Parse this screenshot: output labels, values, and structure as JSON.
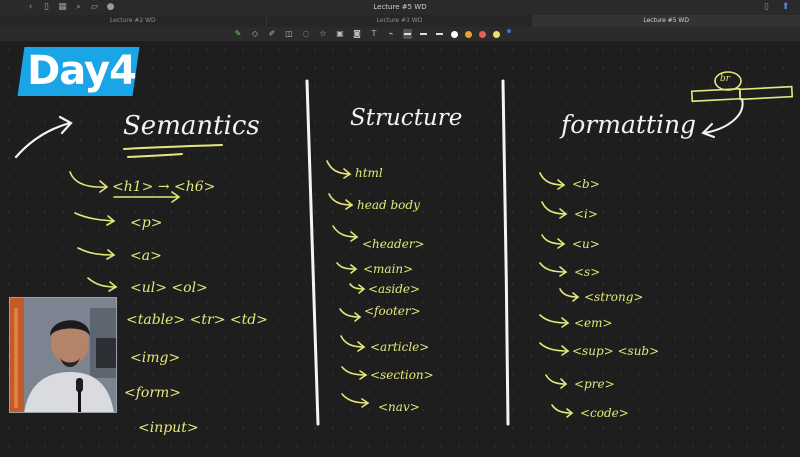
{
  "titlebar": {
    "document_title": "Lecture #5 WD",
    "icons": [
      "back-icon",
      "sidebar-icon",
      "grid-icon",
      "search-icon",
      "bookmark-icon",
      "mic-icon"
    ],
    "right_icons": [
      "bookmark-icon",
      "share-icon"
    ]
  },
  "tabs": [
    {
      "label": "Lecture #2 WD",
      "active": false
    },
    {
      "label": "Lecture #3 WD",
      "active": false
    },
    {
      "label": "Lecture #5 WD",
      "active": true
    }
  ],
  "toolbar": {
    "tools": [
      "pen-icon",
      "eraser-icon",
      "highlighter-icon",
      "shapes-icon",
      "lasso-icon",
      "sticker-icon",
      "image-icon",
      "camera-icon",
      "text-icon",
      "link-icon"
    ],
    "swatch_colors": [
      "#ffffff",
      "#f0a030",
      "#e06060",
      "#e8e070",
      "#3e6fd8"
    ]
  },
  "badge": {
    "text": "Day4",
    "color": "#1aa5e6"
  },
  "notes": {
    "semantics": {
      "heading": "Semantics",
      "items": [
        "<h1> → <h6>",
        "<p>",
        "<a>",
        "<ul> <ol>",
        "<table> <tr> <td>",
        "<img>",
        "<form>",
        "<input>"
      ]
    },
    "structure": {
      "heading": "Structure",
      "items": [
        "html",
        "head body",
        "<header>",
        "<main>",
        "<aside>",
        "<footer>",
        "<article>",
        "<section>",
        "<nav>"
      ]
    },
    "formatting": {
      "heading": "formatting",
      "sketch_label": "br",
      "items": [
        "<b>",
        "<i>",
        "<u>",
        "<s>",
        "<strong>",
        "<em>",
        "<sup> <sub>",
        "<pre>",
        "<code>"
      ]
    }
  },
  "colors": {
    "ink_heading": "#f2f2f2",
    "ink_items": "#e4e87a",
    "canvas": "#1e1e1e"
  }
}
